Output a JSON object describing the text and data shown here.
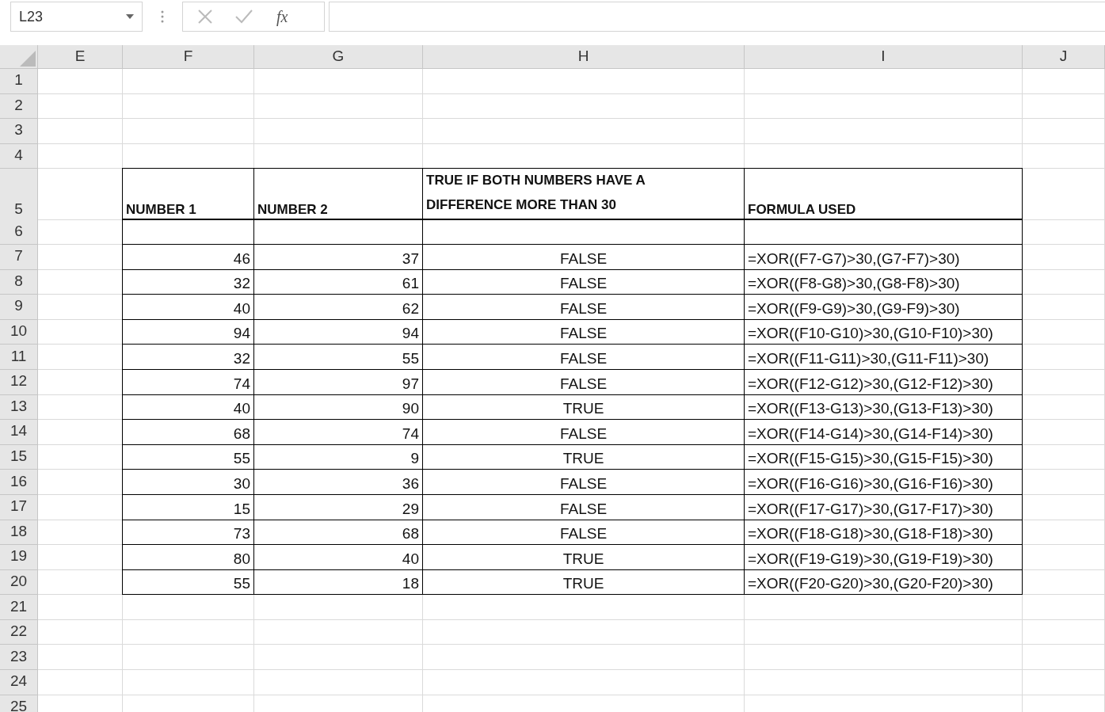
{
  "name_box": {
    "value": "L23"
  },
  "formula_bar": {
    "function_label": "fx"
  },
  "sheet": {
    "columns": [
      "E",
      "F",
      "G",
      "H",
      "I",
      "J"
    ],
    "rows_above": [
      "1",
      "2",
      "3",
      "4"
    ],
    "table": {
      "header_row": "5",
      "headers": [
        "NUMBER 1",
        "NUMBER 2",
        "TRUE IF BOTH NUMBERS HAVE A DIFFERENCE MORE THAN 30",
        "FORMULA USED"
      ],
      "blank_row": "6",
      "rows": [
        {
          "row": "7",
          "number_1": "46",
          "number_2": "37",
          "result": "FALSE",
          "formula": "=XOR((F7-G7)>30,(G7-F7)>30)"
        },
        {
          "row": "8",
          "number_1": "32",
          "number_2": "61",
          "result": "FALSE",
          "formula": "=XOR((F8-G8)>30,(G8-F8)>30)"
        },
        {
          "row": "9",
          "number_1": "40",
          "number_2": "62",
          "result": "FALSE",
          "formula": "=XOR((F9-G9)>30,(G9-F9)>30)"
        },
        {
          "row": "10",
          "number_1": "94",
          "number_2": "94",
          "result": "FALSE",
          "formula": "=XOR((F10-G10)>30,(G10-F10)>30)"
        },
        {
          "row": "11",
          "number_1": "32",
          "number_2": "55",
          "result": "FALSE",
          "formula": "=XOR((F11-G11)>30,(G11-F11)>30)"
        },
        {
          "row": "12",
          "number_1": "74",
          "number_2": "97",
          "result": "FALSE",
          "formula": "=XOR((F12-G12)>30,(G12-F12)>30)"
        },
        {
          "row": "13",
          "number_1": "40",
          "number_2": "90",
          "result": "TRUE",
          "formula": "=XOR((F13-G13)>30,(G13-F13)>30)"
        },
        {
          "row": "14",
          "number_1": "68",
          "number_2": "74",
          "result": "FALSE",
          "formula": "=XOR((F14-G14)>30,(G14-F14)>30)"
        },
        {
          "row": "15",
          "number_1": "55",
          "number_2": "9",
          "result": "TRUE",
          "formula": "=XOR((F15-G15)>30,(G15-F15)>30)"
        },
        {
          "row": "16",
          "number_1": "30",
          "number_2": "36",
          "result": "FALSE",
          "formula": "=XOR((F16-G16)>30,(G16-F16)>30)"
        },
        {
          "row": "17",
          "number_1": "15",
          "number_2": "29",
          "result": "FALSE",
          "formula": "=XOR((F17-G17)>30,(G17-F17)>30)"
        },
        {
          "row": "18",
          "number_1": "73",
          "number_2": "68",
          "result": "FALSE",
          "formula": "=XOR((F18-G18)>30,(G18-F18)>30)"
        },
        {
          "row": "19",
          "number_1": "80",
          "number_2": "40",
          "result": "TRUE",
          "formula": "=XOR((F19-G19)>30,(G19-F19)>30)"
        },
        {
          "row": "20",
          "number_1": "55",
          "number_2": "18",
          "result": "TRUE",
          "formula": "=XOR((F20-G20)>30,(G20-F20)>30)"
        }
      ]
    },
    "rows_below": [
      "21",
      "22",
      "23",
      "24",
      "25"
    ]
  }
}
